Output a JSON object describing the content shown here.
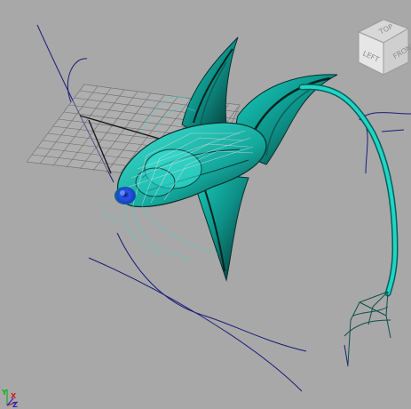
{
  "viewport": {
    "background": "#a8a8a8",
    "object": "bird-like winged creature model with long tail",
    "colors": {
      "body_fill": "#18c7bb",
      "body_dark": "#0a2f2c",
      "grid": "#6e6e6e",
      "curve": "#1c1c7a",
      "eye": "#1a3fd6"
    }
  },
  "viewcube": {
    "top_label": "TOP",
    "left_label": "LEFT",
    "front_label": "FRONT"
  },
  "axis_gizmo": {
    "y_label": "Y",
    "x_label": "X",
    "z_label": "Z",
    "y_color": "#18b018",
    "x_color": "#d01818",
    "z_color": "#1828d0"
  }
}
